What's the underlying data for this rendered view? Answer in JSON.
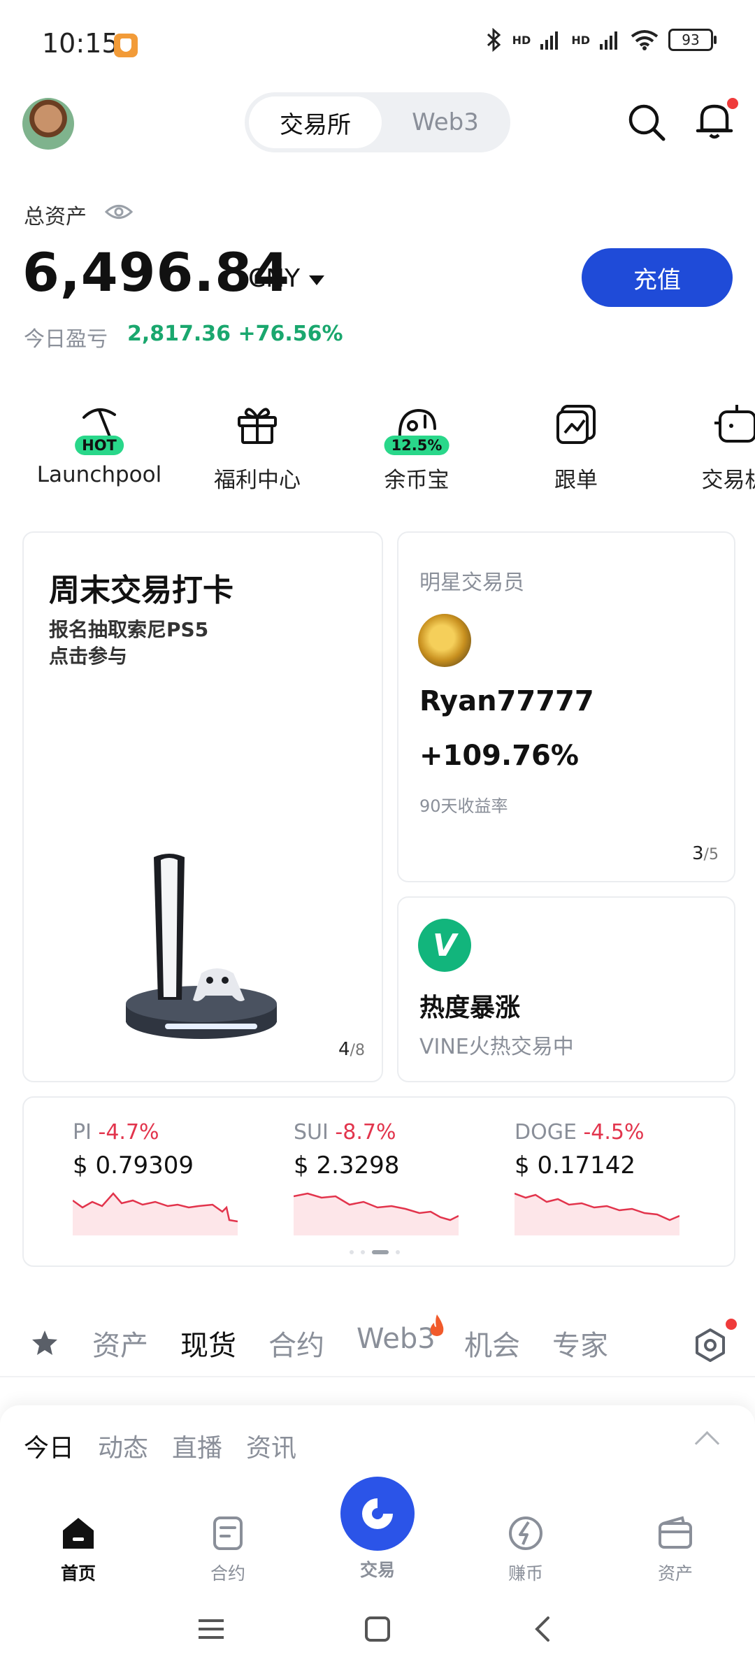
{
  "status_bar": {
    "time": "10:15",
    "hd1": "HD",
    "hd2": "HD",
    "battery": "93"
  },
  "header": {
    "toggle_active": "交易所",
    "toggle_inactive": "Web3"
  },
  "assets": {
    "label": "总资产",
    "amount": "6,496.84",
    "currency": "CNY",
    "deposit_label": "充值",
    "pnl_label": "今日盈亏",
    "pnl_value": "2,817.36 +76.56%"
  },
  "shortcuts": [
    {
      "label": "Launchpool",
      "badge": "HOT",
      "icon": "pickaxe-icon"
    },
    {
      "label": "福利中心",
      "badge": "",
      "icon": "gift-icon"
    },
    {
      "label": "余币宝",
      "badge": "12.5%",
      "icon": "savings-icon"
    },
    {
      "label": "跟单",
      "badge": "",
      "icon": "copytrade-icon"
    },
    {
      "label": "交易机",
      "badge": "",
      "icon": "bot-icon"
    }
  ],
  "promo_card": {
    "title": "周末交易打卡",
    "sub1": "报名抽取索尼PS5",
    "sub2": "点击参与",
    "page": "4",
    "page_total": "/8"
  },
  "star_trader": {
    "title": "明星交易员",
    "name": "Ryan77777",
    "return": "+109.76%",
    "sub": "90天收益率",
    "page": "3",
    "page_total": "/5"
  },
  "hot_card": {
    "logo": "V",
    "title": "热度暴涨",
    "sub": "VINE火热交易中"
  },
  "tickers": [
    {
      "symbol": "PI",
      "change": "-4.7%",
      "price": "$ 0.79309"
    },
    {
      "symbol": "SUI",
      "change": "-8.7%",
      "price": "$ 2.3298"
    },
    {
      "symbol": "DOGE",
      "change": "-4.5%",
      "price": "$ 0.17142"
    }
  ],
  "market_tabs": [
    "资产",
    "现货",
    "合约",
    "Web3",
    "机会",
    "专家"
  ],
  "sheet_tabs": [
    "今日",
    "动态",
    "直播",
    "资讯"
  ],
  "bottom_nav": [
    {
      "label": "首页",
      "icon": "home-icon"
    },
    {
      "label": "合约",
      "icon": "contract-icon"
    },
    {
      "label": "交易",
      "icon": "trade-icon"
    },
    {
      "label": "赚币",
      "icon": "earn-icon"
    },
    {
      "label": "资产",
      "icon": "wallet-icon"
    }
  ],
  "colors": {
    "accent": "#1f4bd8",
    "up": "#1aa76e",
    "down": "#e2344c",
    "badge_green": "#29d78a"
  }
}
